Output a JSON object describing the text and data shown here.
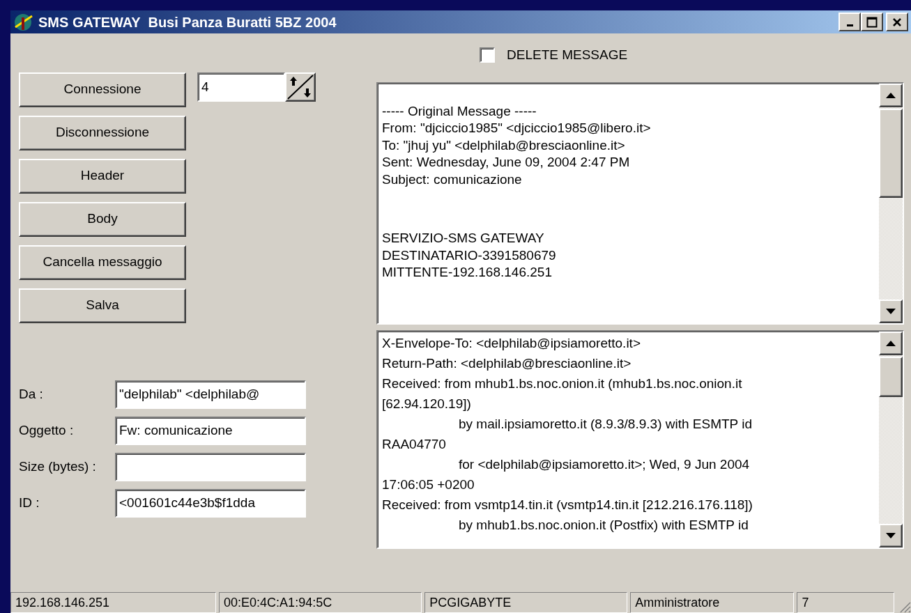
{
  "window": {
    "title": "SMS GATEWAY  Busi Panza Buratti 5BZ 2004"
  },
  "delete_message": {
    "label": "DELETE MESSAGE",
    "checked": false
  },
  "buttons": [
    "Connessione",
    "Disconnessione",
    "Header",
    "Body",
    "Cancella messaggio",
    "Salva"
  ],
  "spin": {
    "value": "4"
  },
  "message_memo": {
    "groups": [
      [
        "----- Original Message -----",
        "From: \"djciccio1985\" <djciccio1985@libero.it>",
        "To: \"jhuj yu\" <delphilab@bresciaonline.it>",
        "Sent: Wednesday, June 09, 2004 2:47 PM",
        "Subject: comunicazione"
      ],
      [
        "SERVIZIO-SMS GATEWAY",
        "DESTINATARIO-3391580679",
        "MITTENTE-192.168.146.251"
      ]
    ]
  },
  "header_memo": {
    "lines": [
      "X-Envelope-To: <delphilab@ipsiamoretto.it>",
      "Return-Path: <delphilab@bresciaonline.it>",
      "Received: from mhub1.bs.noc.onion.it (mhub1.bs.noc.onion.it",
      "[62.94.120.19])",
      "\tby mail.ipsiamoretto.it (8.9.3/8.9.3) with ESMTP id",
      "RAA04770",
      "\tfor <delphilab@ipsiamoretto.it>; Wed, 9 Jun 2004",
      "17:06:05 +0200",
      "Received: from vsmtp14.tin.it (vsmtp14.tin.it [212.216.176.118])",
      "\tby mhub1.bs.noc.onion.it (Postfix) with ESMTP id"
    ]
  },
  "fields": [
    {
      "label": "Da :",
      "value": "\"delphilab\" <delphilab@"
    },
    {
      "label": "Oggetto :",
      "value": "Fw: comunicazione"
    },
    {
      "label": "Size (bytes) :"
    },
    {
      "label": "ID :",
      "value": "<001601c44e3b$f1dda"
    }
  ],
  "status_bar": [
    "192.168.146.251",
    "00:E0:4C:A1:94:5C",
    "PCGIGABYTE",
    "Amministratore",
    "7"
  ]
}
